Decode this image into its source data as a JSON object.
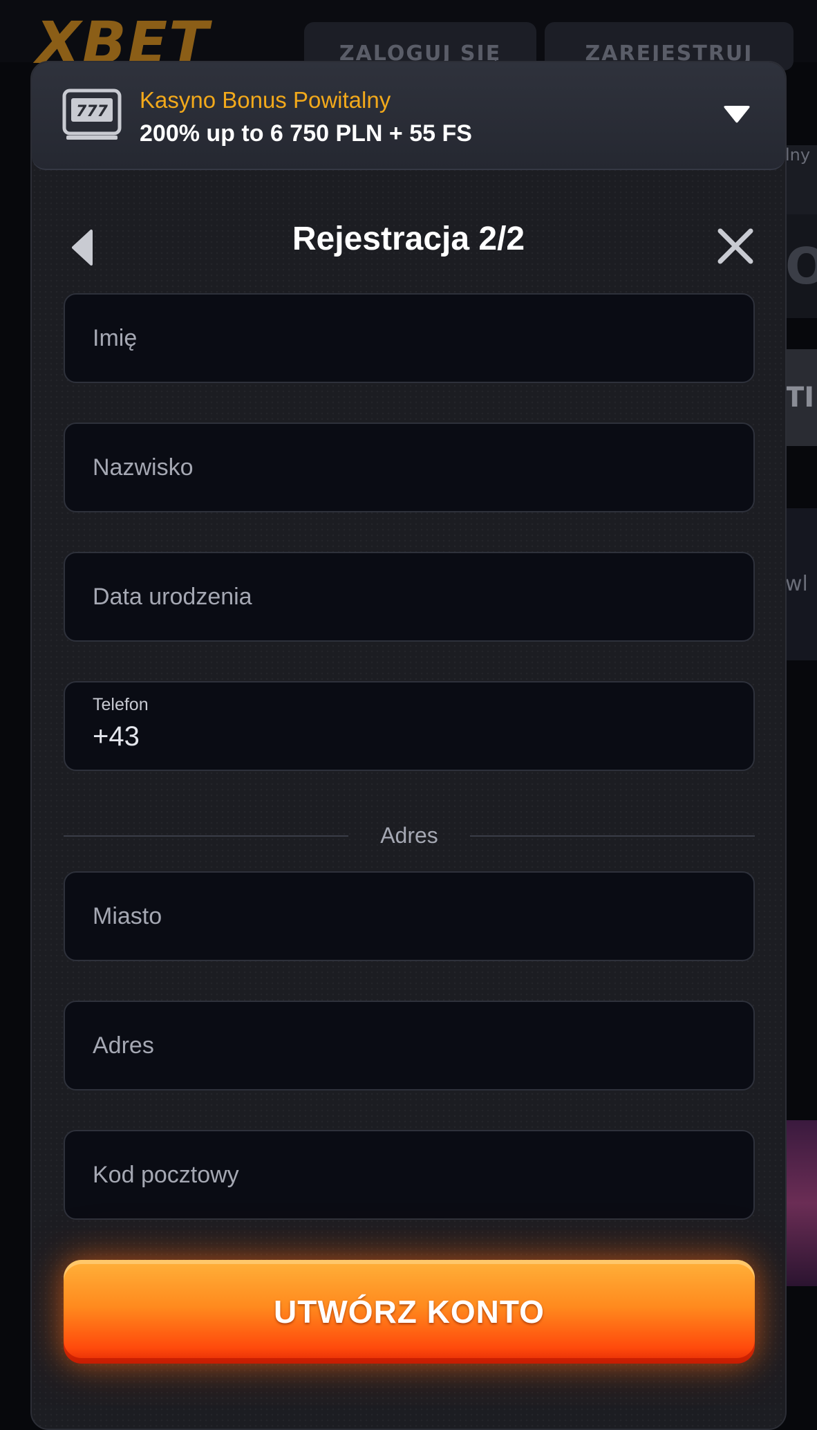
{
  "background": {
    "logo_text": "XBET",
    "login_label": "ZALOGUJ SIĘ",
    "register_label": "ZAREJESTRUJ",
    "strip_fragments": [
      "lny",
      "O",
      "TI",
      "wl"
    ]
  },
  "bonus": {
    "title": "Kasyno Bonus Powitalny",
    "subtitle": "200% up to 6 750 PLN + 55 FS",
    "title_color": "#f2a91b",
    "icon": "slot-machine-777-icon"
  },
  "modal": {
    "title": "Rejestracja 2/2"
  },
  "form": {
    "first_name": {
      "placeholder": "Imię",
      "value": ""
    },
    "last_name": {
      "placeholder": "Nazwisko",
      "value": ""
    },
    "birth_date": {
      "placeholder": "Data urodzenia",
      "value": ""
    },
    "phone": {
      "label": "Telefon",
      "value": "+43"
    },
    "address_section_label": "Adres",
    "city": {
      "placeholder": "Miasto",
      "value": ""
    },
    "address": {
      "placeholder": "Adres",
      "value": ""
    },
    "postal_code": {
      "placeholder": "Kod pocztowy",
      "value": ""
    }
  },
  "submit": {
    "label": "UTWÓRZ KONTO",
    "color": "#ff7a1a"
  }
}
